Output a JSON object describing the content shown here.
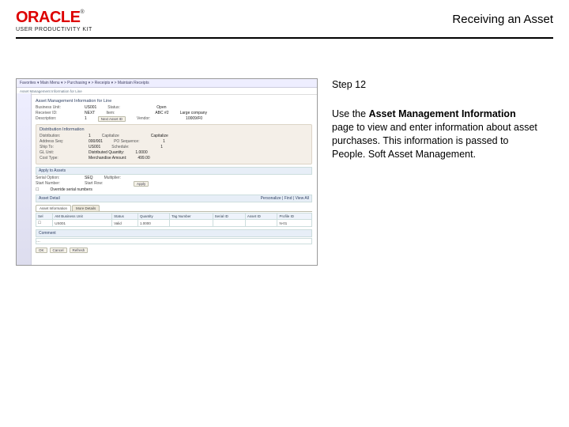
{
  "header": {
    "logo_main": "ORACLE",
    "logo_tm": "®",
    "logo_sub": "USER PRODUCTIVITY KIT",
    "title": "Receiving an Asset"
  },
  "step": {
    "label": "Step 12",
    "text_pre": "Use the ",
    "text_bold": "Asset Management Information",
    "text_post": " page to view and enter information about asset purchases. This information is passed to People. Soft Asset Management."
  },
  "screenshot": {
    "topnav": "Favorites ▾   Main Menu ▾  >  Purchasing ▾  >  Receipts ▾  >  Maintain Receipts",
    "breadcrumb": "Asset Management Information for Line",
    "section_hdr": "Asset Management Information for Line",
    "fields": {
      "bu_lbl": "Business Unit:",
      "bu_val": "US001",
      "recv_lbl": "Receiver ID:",
      "recv_val": "NEXT",
      "desc_lbl": "Description:",
      "desc_val": "1",
      "status_lbl": "Status:",
      "status_val": "Open",
      "item_lbl": "Item:",
      "item_val": "ABC #2",
      "lg_lbl": "Large company",
      "nextasset_btn": "Next Asset ID",
      "vendor_lbl": "Vendor:",
      "vendor_val": "10009/F0"
    },
    "box_hdr": "Distribution Information",
    "box": {
      "dist_lbl": "Distribution:",
      "dist_val": "1",
      "cap_lbl": "Capitalize",
      "cap_val": "Capitalize",
      "addr_lbl": "Address Seq:",
      "addr_val": "000/001",
      "fin_lbl": "PO Sequence:",
      "fin_val": "1",
      "ship_lbl": "Ship To:",
      "ship_val": "US001",
      "sch_lbl": "Schedule:",
      "sch_val": "1",
      "gl_lbl": "GL Unit:",
      "qty_lbl": "Distributed Quantity:",
      "qty_val": "1.0000",
      "cost_lbl": "Cost Type:",
      "amt_lbl": "Merchandise Amount:",
      "amt_val": "499.00"
    },
    "apply": {
      "hdr": "Apply to Assets",
      "serop_lbl": "Serial Option:",
      "serop_val": "SEQ",
      "start_lbl": "Start Number:",
      "multi_lbl": "Multiplier:",
      "startrow_lbl": "Start Row:",
      "override_chk": "Override serial numbers",
      "apply_btn": "Apply"
    },
    "detail_hdr": "Asset Detail",
    "tabs": {
      "t1": "Asset Information",
      "t2": "More Details"
    },
    "view_links": "Personalize | Find | View All",
    "table": {
      "h1": "Sel",
      "h2": "AM Business Unit",
      "h3": "Status",
      "h4": "Quantity",
      "h5": "Tag Number",
      "h6": "Serial ID",
      "h7": "Asset ID",
      "h8": "Profile ID",
      "r1c2": "US001",
      "r1c3": "Valid",
      "r1c4": "1.0000",
      "r1c7": "",
      "r1c8": "N-01"
    },
    "comment": {
      "hdr": "Comment",
      "body": "…"
    },
    "save": {
      "ok": "OK",
      "cancel": "Cancel",
      "refresh": "Refresh"
    }
  }
}
